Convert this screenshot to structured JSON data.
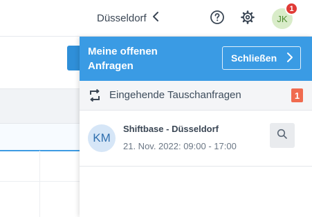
{
  "topbar": {
    "location_label": "Düsseldorf",
    "avatar_initials": "JK",
    "notification_count": "1"
  },
  "panel": {
    "title": "Meine offenen Anfragen",
    "close_label": "Schließen",
    "section": {
      "label": "Eingehende Tauschanfragen",
      "count": "1"
    },
    "requests": [
      {
        "initials": "KM",
        "title": "Shiftbase - Düsseldorf",
        "time": "21. Nov. 2022: 09:00 - 17:00"
      }
    ]
  },
  "colors": {
    "accent": "#3a9be4",
    "badge_red": "#e03a36",
    "count_badge": "#f06b4f",
    "avatar_green_bg": "#d9ecc9"
  }
}
